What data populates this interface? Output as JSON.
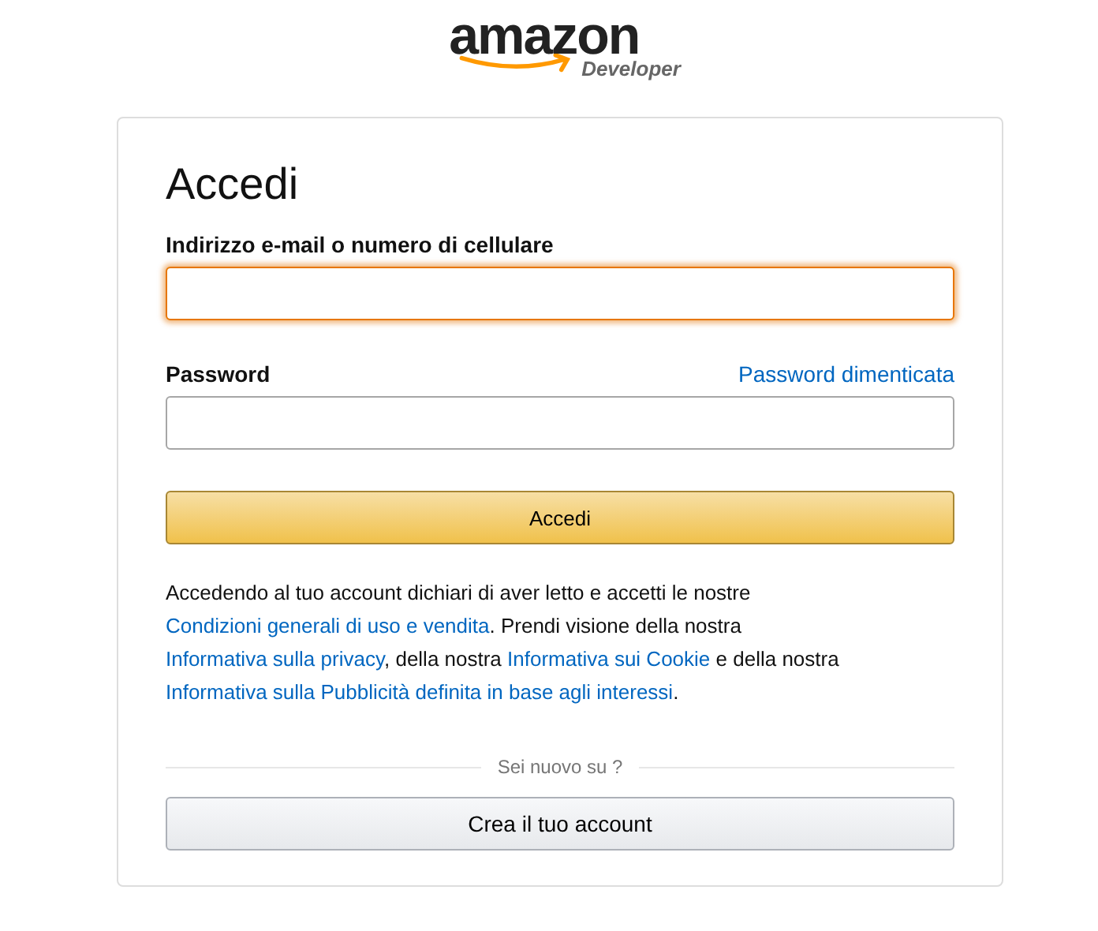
{
  "logo": {
    "wordmark": "amazon",
    "subtitle": "Developer"
  },
  "title": "Accedi",
  "fields": [
    {
      "label": "Indirizzo e-mail o numero di cellulare",
      "focused": true
    },
    {
      "label": "Password",
      "focused": false,
      "link": "Password dimenticata"
    }
  ],
  "submit": "Accedi",
  "legal": [
    {
      "text": "Accedendo al tuo account dichiari di aver letto e accetti le nostre ",
      "link": false
    },
    {
      "text": "Condizioni generali di uso e vendita",
      "link": true
    },
    {
      "text": ". Prendi visione della nostra ",
      "link": false
    },
    {
      "text": "Informativa sulla privacy",
      "link": true
    },
    {
      "text": ", della nostra ",
      "link": false
    },
    {
      "text": "Informativa sui Cookie",
      "link": true
    },
    {
      "text": " e della nostra ",
      "link": false
    },
    {
      "text": "Informativa sulla Pubblicità definita in base agli interessi",
      "link": true
    },
    {
      "text": ".",
      "link": false
    }
  ],
  "divider": "Sei nuovo su ?",
  "create": "Crea il tuo account"
}
